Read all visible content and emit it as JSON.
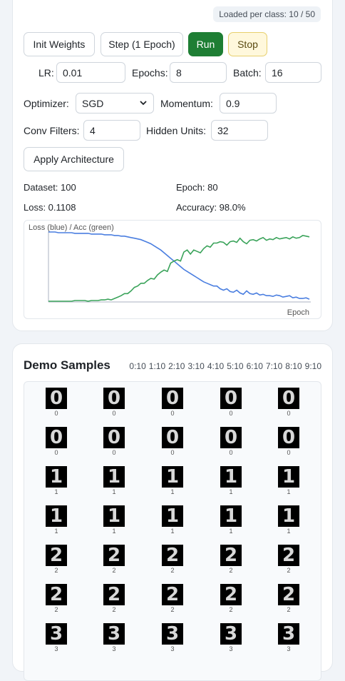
{
  "controls": {
    "loaded_badge": "Loaded per class: 10 / 50",
    "init_label": "Init Weights",
    "step_label": "Step (1 Epoch)",
    "run_label": "Run",
    "stop_label": "Stop",
    "lr_label": "LR:",
    "lr_value": "0.01",
    "epochs_label": "Epochs:",
    "epochs_value": "8",
    "batch_label": "Batch:",
    "batch_value": "16",
    "optimizer_label": "Optimizer:",
    "optimizer_value": "SGD",
    "momentum_label": "Momentum:",
    "momentum_value": "0.9",
    "conv_label": "Conv Filters:",
    "conv_value": "4",
    "hidden_label": "Hidden Units:",
    "hidden_value": "32",
    "apply_label": "Apply Architecture"
  },
  "stats": {
    "dataset": "Dataset: 100",
    "epoch": "Epoch: 80",
    "loss": "Loss: 0.1108",
    "accuracy": "Accuracy: 98.0%"
  },
  "chart_data": {
    "type": "line",
    "title": "Loss (blue) / Acc (green)",
    "xlabel": "Epoch",
    "ylabel": "",
    "ylim": [
      0,
      1
    ],
    "x": [
      1,
      2,
      3,
      4,
      5,
      6,
      7,
      8,
      9,
      10,
      11,
      12,
      13,
      14,
      15,
      16,
      17,
      18,
      19,
      20,
      21,
      22,
      23,
      24,
      25,
      26,
      27,
      28,
      29,
      30,
      31,
      32,
      33,
      34,
      35,
      36,
      37,
      38,
      39,
      40,
      41,
      42,
      43,
      44,
      45,
      46,
      47,
      48,
      49,
      50,
      51,
      52,
      53,
      54,
      55,
      56,
      57,
      58,
      59,
      60,
      61,
      62,
      63,
      64,
      65,
      66,
      67,
      68,
      69,
      70,
      71,
      72,
      73,
      74,
      75,
      76,
      77,
      78,
      79,
      80
    ],
    "series": [
      {
        "values": [
          1.0,
          1.0,
          1.0,
          0.99,
          0.99,
          0.99,
          0.99,
          0.99,
          0.98,
          0.98,
          0.98,
          0.98,
          0.98,
          0.97,
          0.97,
          0.97,
          0.97,
          0.96,
          0.96,
          0.96,
          0.95,
          0.95,
          0.94,
          0.94,
          0.93,
          0.92,
          0.91,
          0.9,
          0.89,
          0.87,
          0.85,
          0.83,
          0.8,
          0.77,
          0.74,
          0.7,
          0.66,
          0.62,
          0.58,
          0.54,
          0.5,
          0.46,
          0.43,
          0.4,
          0.37,
          0.34,
          0.31,
          0.28,
          0.26,
          0.24,
          0.22,
          0.22,
          0.18,
          0.16,
          0.18,
          0.14,
          0.13,
          0.16,
          0.12,
          0.1,
          0.15,
          0.11,
          0.1,
          0.12,
          0.09,
          0.1,
          0.08,
          0.08,
          0.07,
          0.09,
          0.08,
          0.06,
          0.07,
          0.08,
          0.05,
          0.06,
          0.04,
          0.04,
          0.05,
          0.03
        ],
        "color": "#4a7ee0"
      },
      {
        "values": [
          0.0,
          0.0,
          0.0,
          0.0,
          0.0,
          0.0,
          0.0,
          0.0,
          0.01,
          0.01,
          0.01,
          0.01,
          0.0,
          0.01,
          0.01,
          0.01,
          0.02,
          0.02,
          0.03,
          0.02,
          0.04,
          0.06,
          0.08,
          0.11,
          0.11,
          0.15,
          0.2,
          0.22,
          0.26,
          0.26,
          0.3,
          0.33,
          0.32,
          0.38,
          0.42,
          0.45,
          0.43,
          0.55,
          0.58,
          0.6,
          0.58,
          0.71,
          0.74,
          0.68,
          0.74,
          0.72,
          0.7,
          0.76,
          0.8,
          0.78,
          0.84,
          0.84,
          0.86,
          0.85,
          0.81,
          0.86,
          0.87,
          0.85,
          0.91,
          0.86,
          0.83,
          0.88,
          0.89,
          0.87,
          0.9,
          0.92,
          0.88,
          0.9,
          0.89,
          0.92,
          0.9,
          0.91,
          0.92,
          0.9,
          0.93,
          0.91,
          0.92,
          0.95,
          0.94,
          0.93
        ],
        "color": "#3aa35a"
      }
    ]
  },
  "samples": {
    "heading": "Demo Samples",
    "class_counts": [
      "0:10",
      "1:10",
      "2:10",
      "3:10",
      "4:10",
      "5:10",
      "6:10",
      "7:10",
      "8:10",
      "9:10"
    ],
    "rows": [
      [
        "0",
        "0",
        "0",
        "0",
        "0"
      ],
      [
        "0",
        "0",
        "0",
        "0",
        "0"
      ],
      [
        "1",
        "1",
        "1",
        "1",
        "1"
      ],
      [
        "1",
        "1",
        "1",
        "1",
        "1"
      ],
      [
        "2",
        "2",
        "2",
        "2",
        "2"
      ],
      [
        "2",
        "2",
        "2",
        "2",
        "2"
      ],
      [
        "3",
        "3",
        "3",
        "3",
        "3"
      ]
    ]
  }
}
